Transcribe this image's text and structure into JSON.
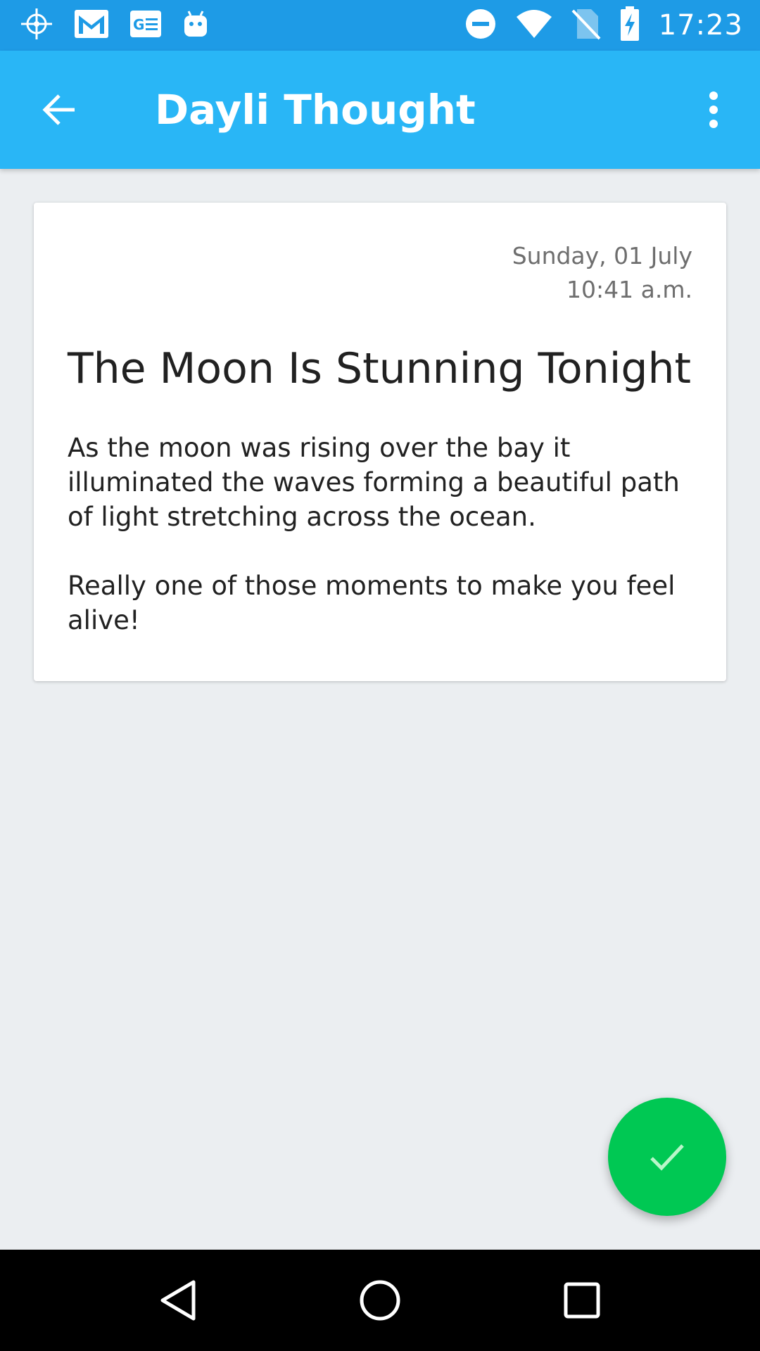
{
  "status_bar": {
    "time": "17:23",
    "background_color": "#1e9be6",
    "left_icons": [
      "crosshair-icon",
      "gmail-icon",
      "news-icon",
      "android-icon"
    ],
    "right_icons": [
      "do-not-disturb-icon",
      "wifi-icon",
      "no-sim-icon",
      "battery-charging-icon"
    ]
  },
  "app_bar": {
    "title": "Dayli Thought",
    "background_color": "#29b6f6",
    "back_icon": "arrow-back-icon",
    "menu_icon": "more-vert-icon"
  },
  "entry": {
    "date": "Sunday, 01 July",
    "time": "10:41 a.m.",
    "title": "The Moon Is Stunning Tonight",
    "paragraphs": [
      "As the moon was rising over the bay it illuminated the waves forming a beautiful path of light stretching across the ocean.",
      "Really one of those moments to make you feel alive!"
    ]
  },
  "fab": {
    "icon": "check-icon",
    "color": "#00c853"
  },
  "nav_bar": {
    "buttons": [
      "back-triangle-icon",
      "home-circle-icon",
      "recents-square-icon"
    ]
  }
}
